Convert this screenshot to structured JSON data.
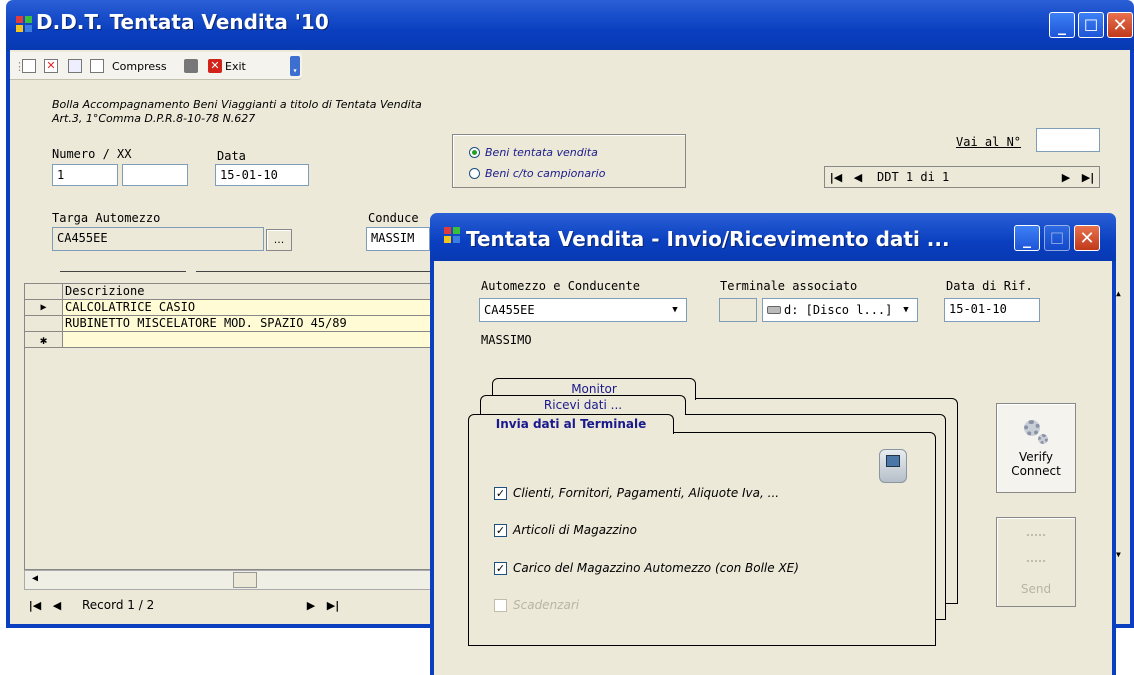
{
  "main_window": {
    "title": "D.D.T. Tentata Vendita  '10",
    "toolbar": {
      "compress": "Compress",
      "exit": "Exit"
    },
    "header_line1": "Bolla Accompagnamento Beni Viaggianti a titolo di Tentata Vendita",
    "header_line2": "Art.3, 1°Comma D.P.R.8-10-78 N.627",
    "numero_label": "Numero  / XX",
    "numero_value": "1",
    "xx_value": "",
    "data_label": "Data",
    "data_value": "15-01-10",
    "radio_beni_tentata": "Beni tentata vendita",
    "radio_beni_campionario": "Beni c/to campionario",
    "vai_al_label": "Vai al N°",
    "vai_al_value": "",
    "ddt_nav_text": "DDT 1  di 1",
    "targa_label": "Targa Automezzo",
    "targa_value": "CA455EE",
    "browse_btn": "...",
    "conducente_label": "Conduce",
    "conducente_value": "MASSIM",
    "grid_header": "Descrizione",
    "grid_rows": [
      "CALCOLATRICE CASIO",
      "RUBINETTO MISCELATORE MOD. SPAZIO 45/89"
    ],
    "record_nav_text": "Record 1 / 2"
  },
  "dialog": {
    "title": "Tentata Vendita - Invio/Ricevimento dati ...",
    "automezzo_label": "Automezzo e Conducente",
    "automezzo_value": "CA455EE",
    "conducente_name": "MASSIMO",
    "terminale_label": "Terminale associato",
    "terminale_value": "d: [Disco l...]",
    "data_rif_label": "Data di Rif.",
    "data_rif_value": "15-01-10",
    "tabs": [
      "Monitor",
      "Ricevi dati ...",
      "Invia dati al Terminale"
    ],
    "checks": [
      {
        "label": "Clienti, Fornitori, Pagamenti, Aliquote Iva, ...",
        "checked": true,
        "enabled": true
      },
      {
        "label": "Articoli di Magazzino",
        "checked": true,
        "enabled": true
      },
      {
        "label": "Carico del Magazzino Automezzo (con Bolle XE)",
        "checked": true,
        "enabled": true
      },
      {
        "label": "Scadenzari",
        "checked": false,
        "enabled": false
      }
    ],
    "verify_label_1": "Verify",
    "verify_label_2": "Connect",
    "send_label": "Send"
  },
  "colors": {
    "titlebar": "#0a3fc0",
    "face": "#ece9d8",
    "close": "#d0481f",
    "accent_text": "#1a1a8c"
  }
}
